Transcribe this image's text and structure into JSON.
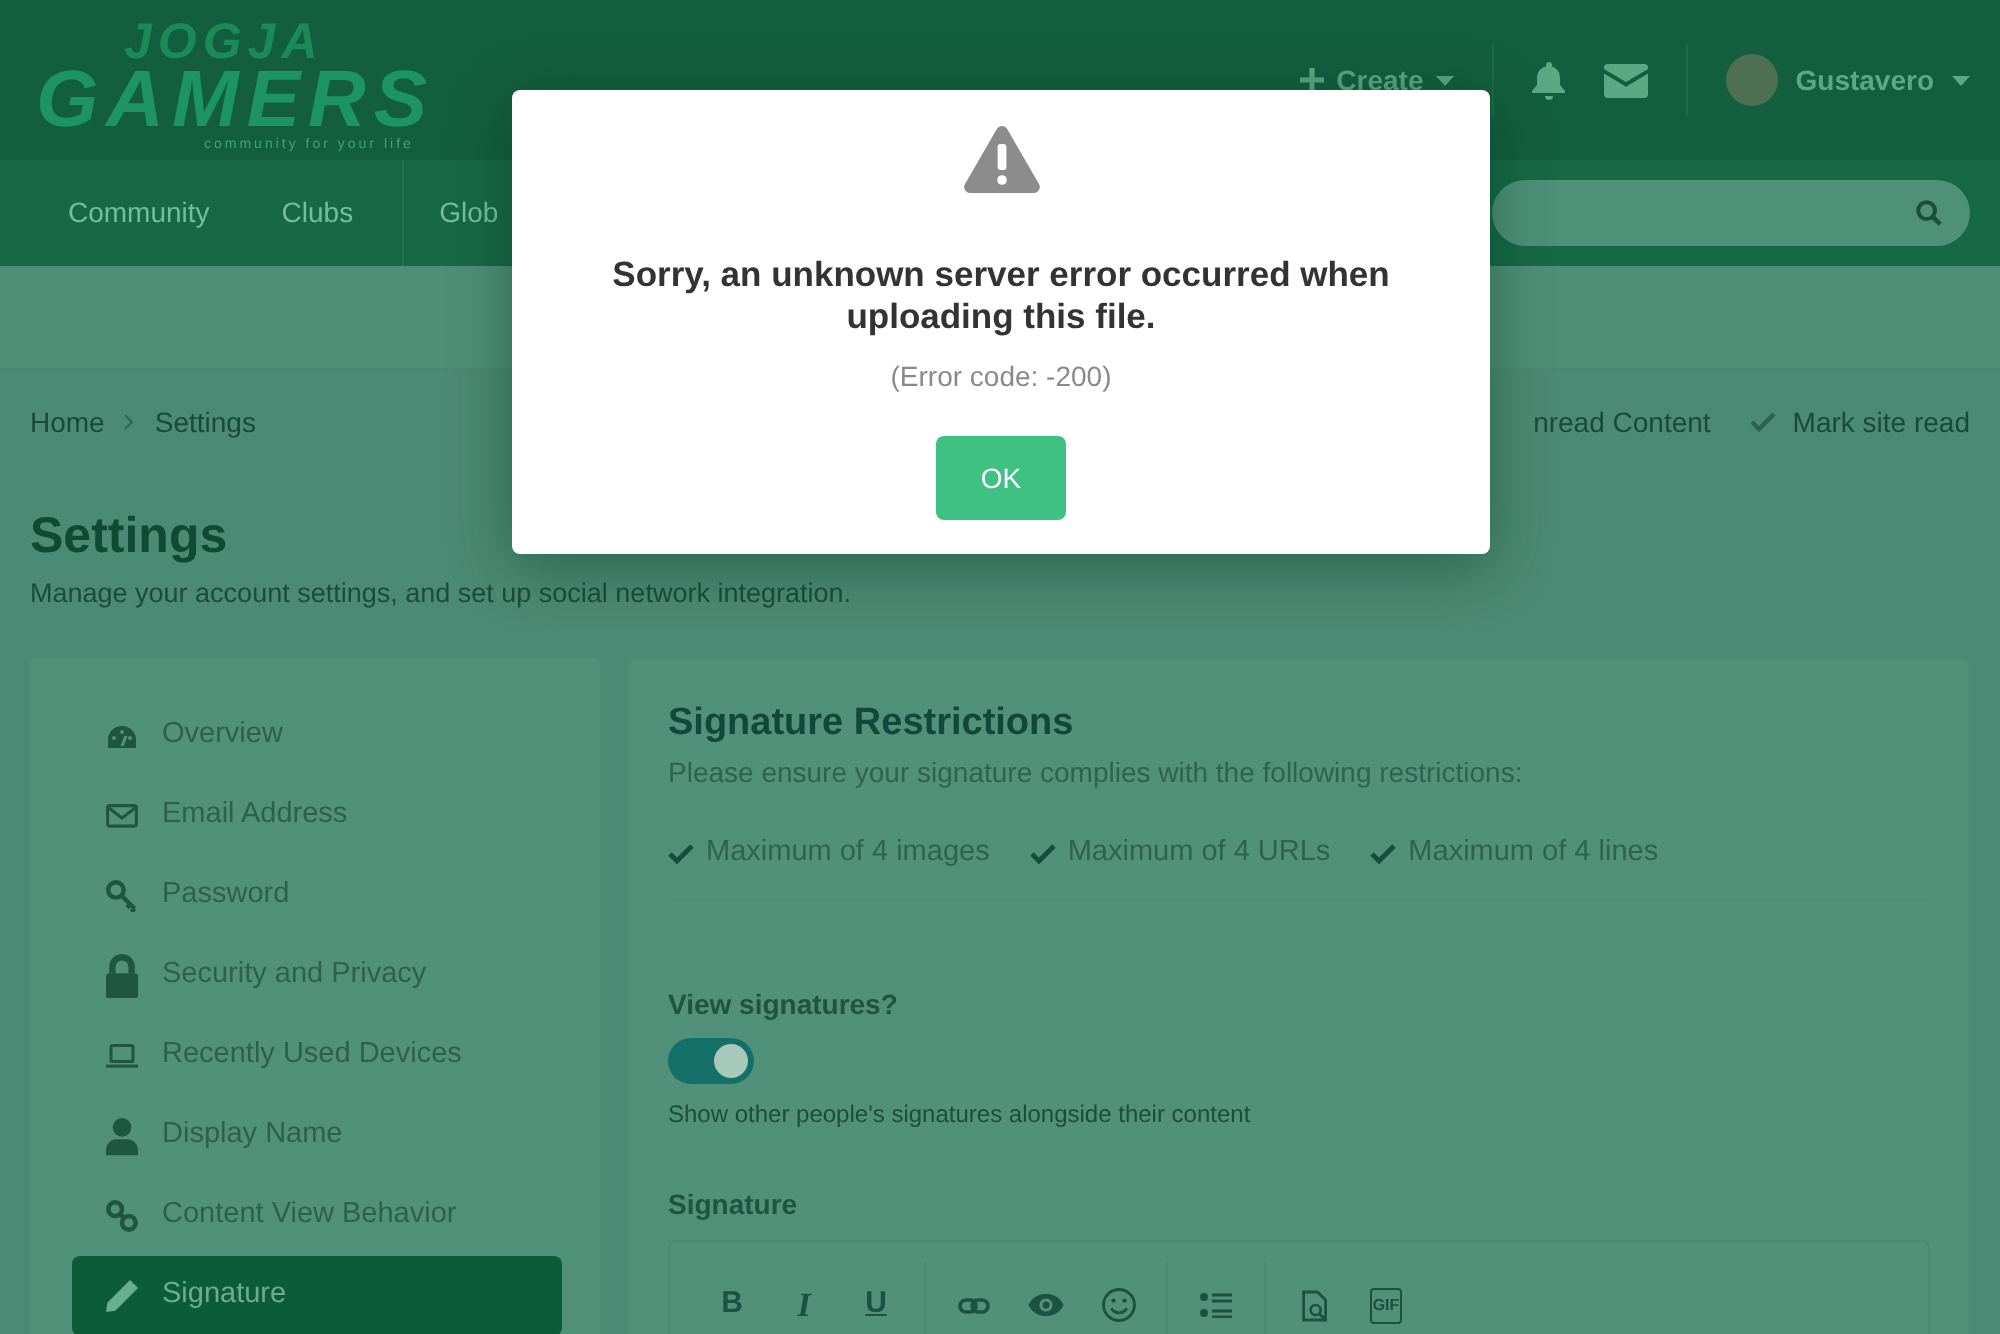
{
  "header": {
    "logo": {
      "top": "JOGJA",
      "main": "GAMERS",
      "tagline": "community for your life"
    },
    "create": {
      "label": "Create"
    },
    "user": {
      "name": "Gustavero"
    }
  },
  "nav": {
    "items": [
      {
        "label": "Community"
      },
      {
        "label": "Clubs"
      },
      {
        "label": "Glob"
      }
    ]
  },
  "breadcrumb": {
    "items": [
      "Home",
      "Settings"
    ],
    "actions": [
      {
        "label": "nread Content",
        "kind": "plain"
      },
      {
        "label": "Mark site read",
        "kind": "check"
      }
    ]
  },
  "page": {
    "title": "Settings",
    "subtitle": "Manage your account settings, and set up social network integration."
  },
  "sidebar": {
    "items": [
      {
        "label": "Overview",
        "kind": "dashboard",
        "selected": false
      },
      {
        "label": "Email Address",
        "kind": "envelope",
        "selected": false
      },
      {
        "label": "Password",
        "kind": "key",
        "selected": false
      },
      {
        "label": "Security and Privacy",
        "kind": "lock",
        "selected": false
      },
      {
        "label": "Recently Used Devices",
        "kind": "laptop",
        "selected": false
      },
      {
        "label": "Display Name",
        "kind": "user",
        "selected": false
      },
      {
        "label": "Content View Behavior",
        "kind": "links",
        "selected": false
      },
      {
        "label": "Signature",
        "kind": "pencil",
        "selected": true
      }
    ]
  },
  "restrictions": {
    "title": "Signature Restrictions",
    "intro": "Please ensure your signature complies with the following restrictions:",
    "items": [
      "Maximum of 4 images",
      "Maximum of 4 URLs",
      "Maximum of 4 lines"
    ]
  },
  "view_signatures": {
    "label": "View signatures?",
    "on": true,
    "hint": "Show other people's signatures alongside their content"
  },
  "signature_editor": {
    "label": "Signature",
    "toolbar": [
      [
        {
          "kind": "bold",
          "label": "B"
        },
        {
          "kind": "italic",
          "label": "I"
        },
        {
          "kind": "underline",
          "label": "U"
        }
      ],
      [
        {
          "kind": "link"
        },
        {
          "kind": "eye"
        },
        {
          "kind": "emoji"
        }
      ],
      [
        {
          "kind": "list"
        }
      ],
      [
        {
          "kind": "preview"
        },
        {
          "kind": "gif",
          "label": "GIF"
        }
      ]
    ]
  },
  "dialog": {
    "title": "Sorry, an unknown server error occurred when uploading this file.",
    "detail": "(Error code: -200)",
    "button": "OK"
  }
}
